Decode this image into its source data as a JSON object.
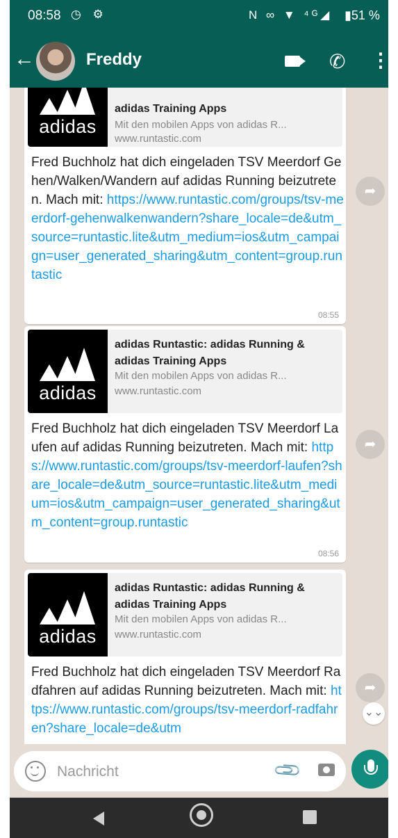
{
  "status_bar": {
    "time": "08:58",
    "left_icons": "◷ ⚙",
    "right_icons": "N ∞ ▼ ⁴ᴳ◢",
    "battery": "▮51 %"
  },
  "app_bar": {
    "back_glyph": "←",
    "contact_name": "Freddy",
    "phone_glyph": "✆",
    "more_glyph": "⋮"
  },
  "messages": [
    {
      "preview_title": "adidas Training Apps",
      "preview_desc": "Mit den mobilen Apps von adidas R...",
      "preview_domain": "www.runtastic.com",
      "text": "Fred Buchholz hat dich eingeladen TSV Meerdorf Gehen/Walken/Wandern auf adidas Running beizutreten. Mach mit:",
      "link": "https://www.runtastic.com/groups/tsv-meerdorf-gehenwalkenwandern?share_locale=de&utm_source=runtastic.lite&utm_medium=ios&utm_campaign=user_generated_sharing&utm_content=group.runtastic",
      "time": "08:55"
    },
    {
      "preview_title": "adidas Runtastic: adidas Running & adidas Training Apps",
      "preview_desc": "Mit den mobilen Apps von adidas R...",
      "preview_domain": "www.runtastic.com",
      "text": "Fred Buchholz hat dich eingeladen TSV Meerdorf Laufen auf adidas Running beizutreten. Mach mit:",
      "link": "https://www.runtastic.com/groups/tsv-meerdorf-laufen?share_locale=de&utm_source=runtastic.lite&utm_medium=ios&utm_campaign=user_generated_sharing&utm_content=group.runtastic",
      "time": "08:56"
    },
    {
      "preview_title": "adidas Runtastic: adidas Running & adidas Training Apps",
      "preview_desc": "Mit den mobilen Apps von adidas R...",
      "preview_domain": "www.runtastic.com",
      "text": "Fred Buchholz hat dich eingeladen TSV Meerdorf Radfahren auf adidas Running beizutreten. Mach mit:",
      "link": "https://www.runtastic.com/groups/tsv-meerdorf-radfahren?share_locale=de&utm",
      "time": ""
    }
  ],
  "thumb_label": "adidas",
  "forward_glyph": "➦",
  "scroll_down_glyph": "⌄⌄",
  "composer": {
    "placeholder": "Nachricht",
    "attach_glyph": "📎"
  },
  "colors": {
    "header": "#075e54",
    "chat_bg": "#e5ddd5",
    "link": "#1a9be6",
    "mic_button": "#128c7e"
  }
}
